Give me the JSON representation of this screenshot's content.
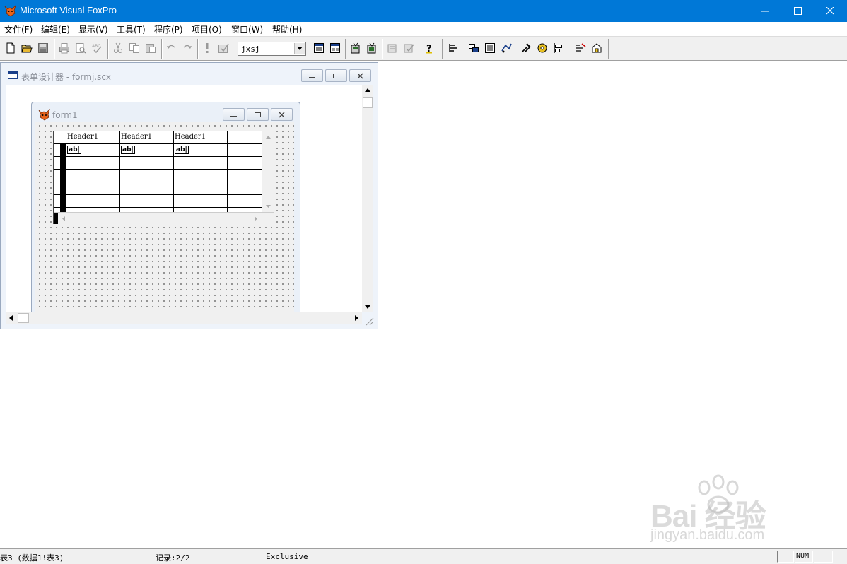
{
  "app": {
    "title": "Microsoft Visual FoxPro",
    "accent_color": "#0078d7"
  },
  "menu": [
    {
      "label": "文件(F)"
    },
    {
      "label": "编辑(E)"
    },
    {
      "label": "显示(V)"
    },
    {
      "label": "工具(T)"
    },
    {
      "label": "程序(P)"
    },
    {
      "label": "项目(O)"
    },
    {
      "label": "窗口(W)"
    },
    {
      "label": "帮助(H)"
    }
  ],
  "toolbar": {
    "database_combo": "jxsj",
    "buttons": [
      "new-icon",
      "open-icon",
      "save-icon",
      "print-icon",
      "print-preview-icon",
      "spelling-icon",
      "cut-icon",
      "copy-icon",
      "paste-icon",
      "undo-icon",
      "redo-icon",
      "run-icon",
      "modify-form-icon",
      "command-window-icon",
      "view-window-icon",
      "data-session-icon",
      "form-wizard-icon",
      "report-wizard-icon",
      "help-icon",
      "layout-icon",
      "properties-icon",
      "code-icon",
      "form-controls-icon",
      "builder-icon",
      "autoformat-icon",
      "align-icon",
      "color-palette-icon",
      "tab-order-icon"
    ]
  },
  "designer": {
    "title": "表单设计器 - formj.scx",
    "form": {
      "title": "form1",
      "grid": {
        "headers": [
          "Header1",
          "Header1",
          "Header1"
        ],
        "textbox_label": "ab|"
      }
    }
  },
  "statusbar": {
    "table": "表3 (数据1!表3)",
    "record": "记录:2/2",
    "mode": "Exclusive",
    "num": "NUM"
  },
  "watermark": {
    "main": "Bai 经验",
    "sub": "jingyan.baidu.com"
  }
}
